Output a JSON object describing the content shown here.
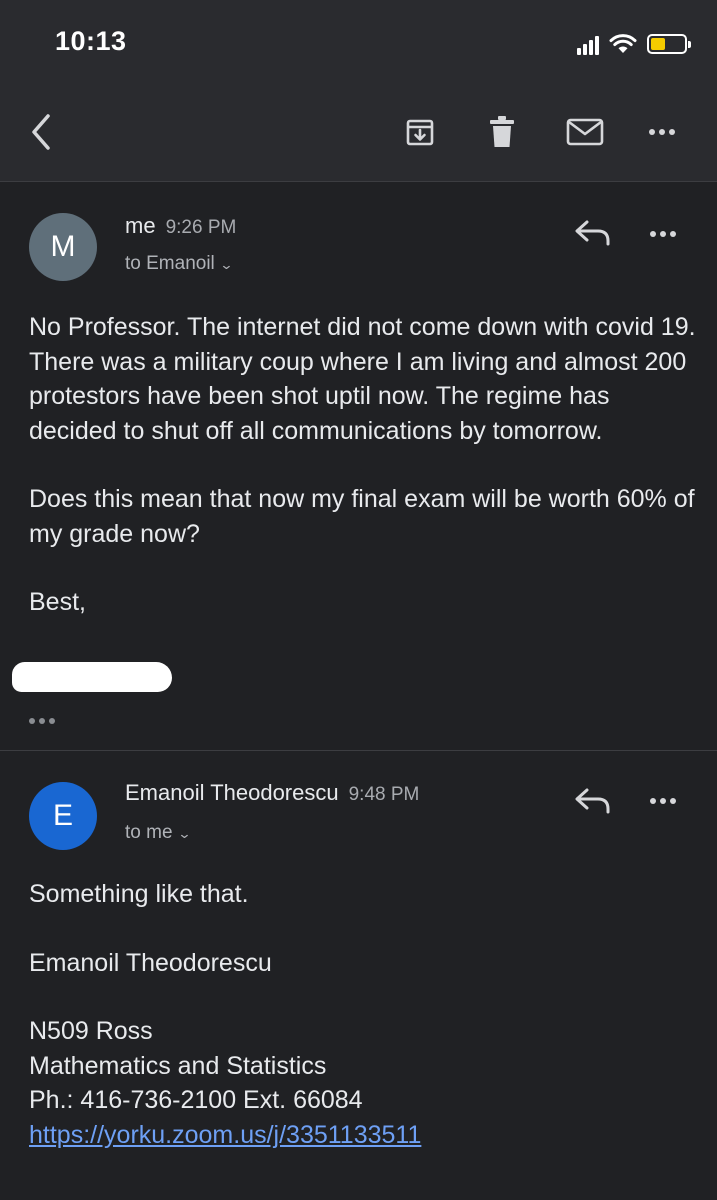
{
  "status_bar": {
    "time": "10:13"
  },
  "toolbar": {
    "icons": [
      "back-arrow-icon",
      "archive-icon",
      "trash-icon",
      "mail-icon",
      "more-icon"
    ]
  },
  "messages": [
    {
      "avatar_letter": "M",
      "avatar_color": "#5f6f7a",
      "sender": "me",
      "time": "9:26 PM",
      "recipient": "to Emanoil",
      "body": [
        "No Professor. The internet did not come down with covid 19. There was a military coup where I am living and almost 200 protestors have been shot uptil now. The regime has decided to shut off all communications by tomorrow.",
        "Does this mean that now my final exam will be worth 60% of my grade now?",
        "Best,"
      ]
    },
    {
      "avatar_letter": "E",
      "avatar_color": "#1967d2",
      "sender": "Emanoil Theodorescu",
      "time": "9:48 PM",
      "recipient": "to me",
      "body": [
        "Something like that.",
        "Emanoil Theodorescu"
      ],
      "signature": [
        "N509 Ross",
        "Mathematics and Statistics",
        "Ph.: 416-736-2100 Ext. 66084"
      ],
      "link": "https://yorku.zoom.us/j/3351133511"
    }
  ]
}
